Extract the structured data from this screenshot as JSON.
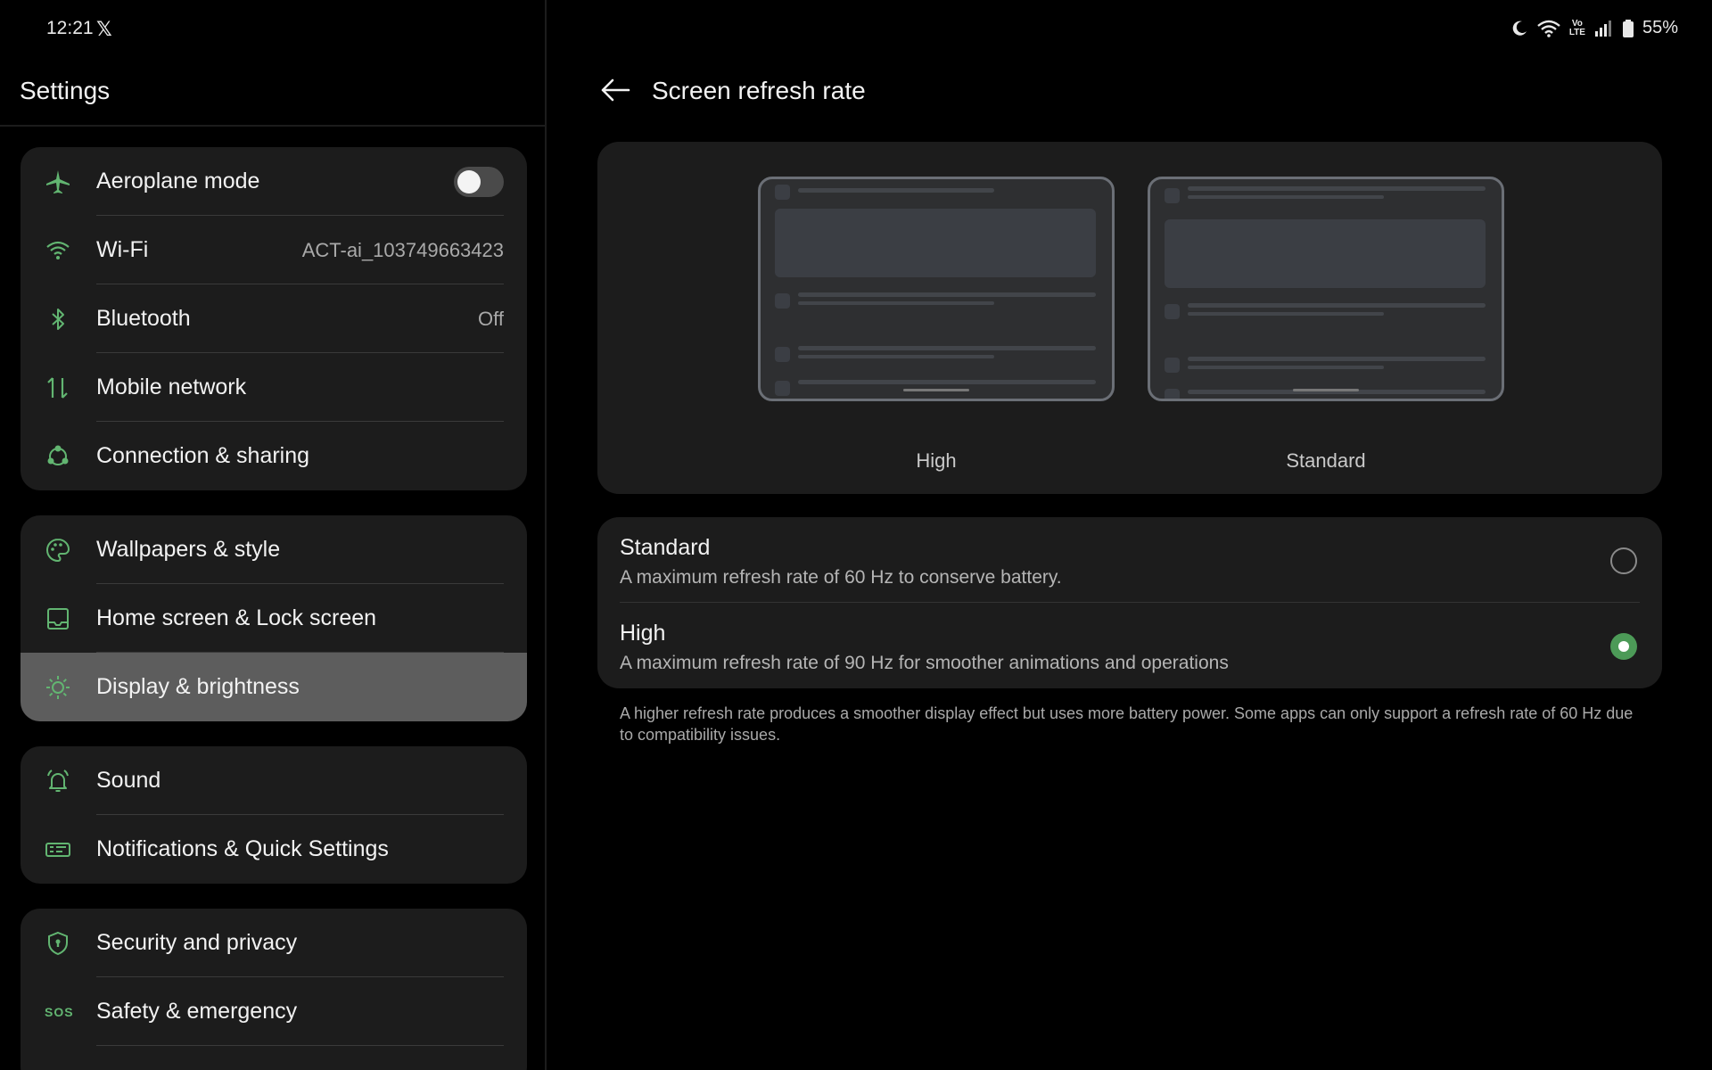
{
  "status_bar": {
    "time": "12:21",
    "notification_icon": "x-logo-icon",
    "battery": "55%",
    "volte_line1": "Vo",
    "volte_line2": "LTE",
    "icons": [
      "moon-icon",
      "wifi-icon",
      "volte-icon",
      "signal-icon",
      "battery-icon"
    ]
  },
  "sidebar": {
    "title": "Settings",
    "groups": [
      {
        "items": [
          {
            "label": "Aeroplane mode",
            "icon": "airplane-icon",
            "toggle_on": false
          },
          {
            "label": "Wi-Fi",
            "icon": "wifi-icon",
            "value": "ACT-ai_103749663423"
          },
          {
            "label": "Bluetooth",
            "icon": "bluetooth-icon",
            "value": "Off"
          },
          {
            "label": "Mobile network",
            "icon": "mobile-data-icon"
          },
          {
            "label": "Connection & sharing",
            "icon": "share-icon"
          }
        ]
      },
      {
        "items": [
          {
            "label": "Wallpapers & style",
            "icon": "palette-icon"
          },
          {
            "label": "Home screen & Lock screen",
            "icon": "home-screen-icon"
          },
          {
            "label": "Display & brightness",
            "icon": "brightness-icon",
            "selected": true
          }
        ]
      },
      {
        "items": [
          {
            "label": "Sound",
            "icon": "bell-icon"
          },
          {
            "label": "Notifications & Quick Settings",
            "icon": "notifications-icon"
          }
        ]
      },
      {
        "items": [
          {
            "label": "Security and privacy",
            "icon": "shield-icon"
          },
          {
            "label": "Safety & emergency",
            "icon": "sos-icon",
            "icon_text": "SOS"
          }
        ]
      }
    ]
  },
  "main": {
    "title": "Screen refresh rate",
    "preview": {
      "high_label": "High",
      "standard_label": "Standard"
    },
    "options": [
      {
        "title": "Standard",
        "description": "A maximum refresh rate of 60 Hz to conserve battery.",
        "selected": false
      },
      {
        "title": "High",
        "description": "A maximum refresh rate of 90 Hz for smoother animations and operations",
        "selected": true
      }
    ],
    "footnote": "A higher refresh rate produces a smoother display effect but uses more battery power. Some apps can only support a refresh rate of 60 Hz due to compatibility issues."
  },
  "colors": {
    "accent": "#62b571",
    "radio_checked": "#4c9a57",
    "card_bg": "#1c1c1c",
    "selected_row_bg": "#5d5d5d"
  }
}
